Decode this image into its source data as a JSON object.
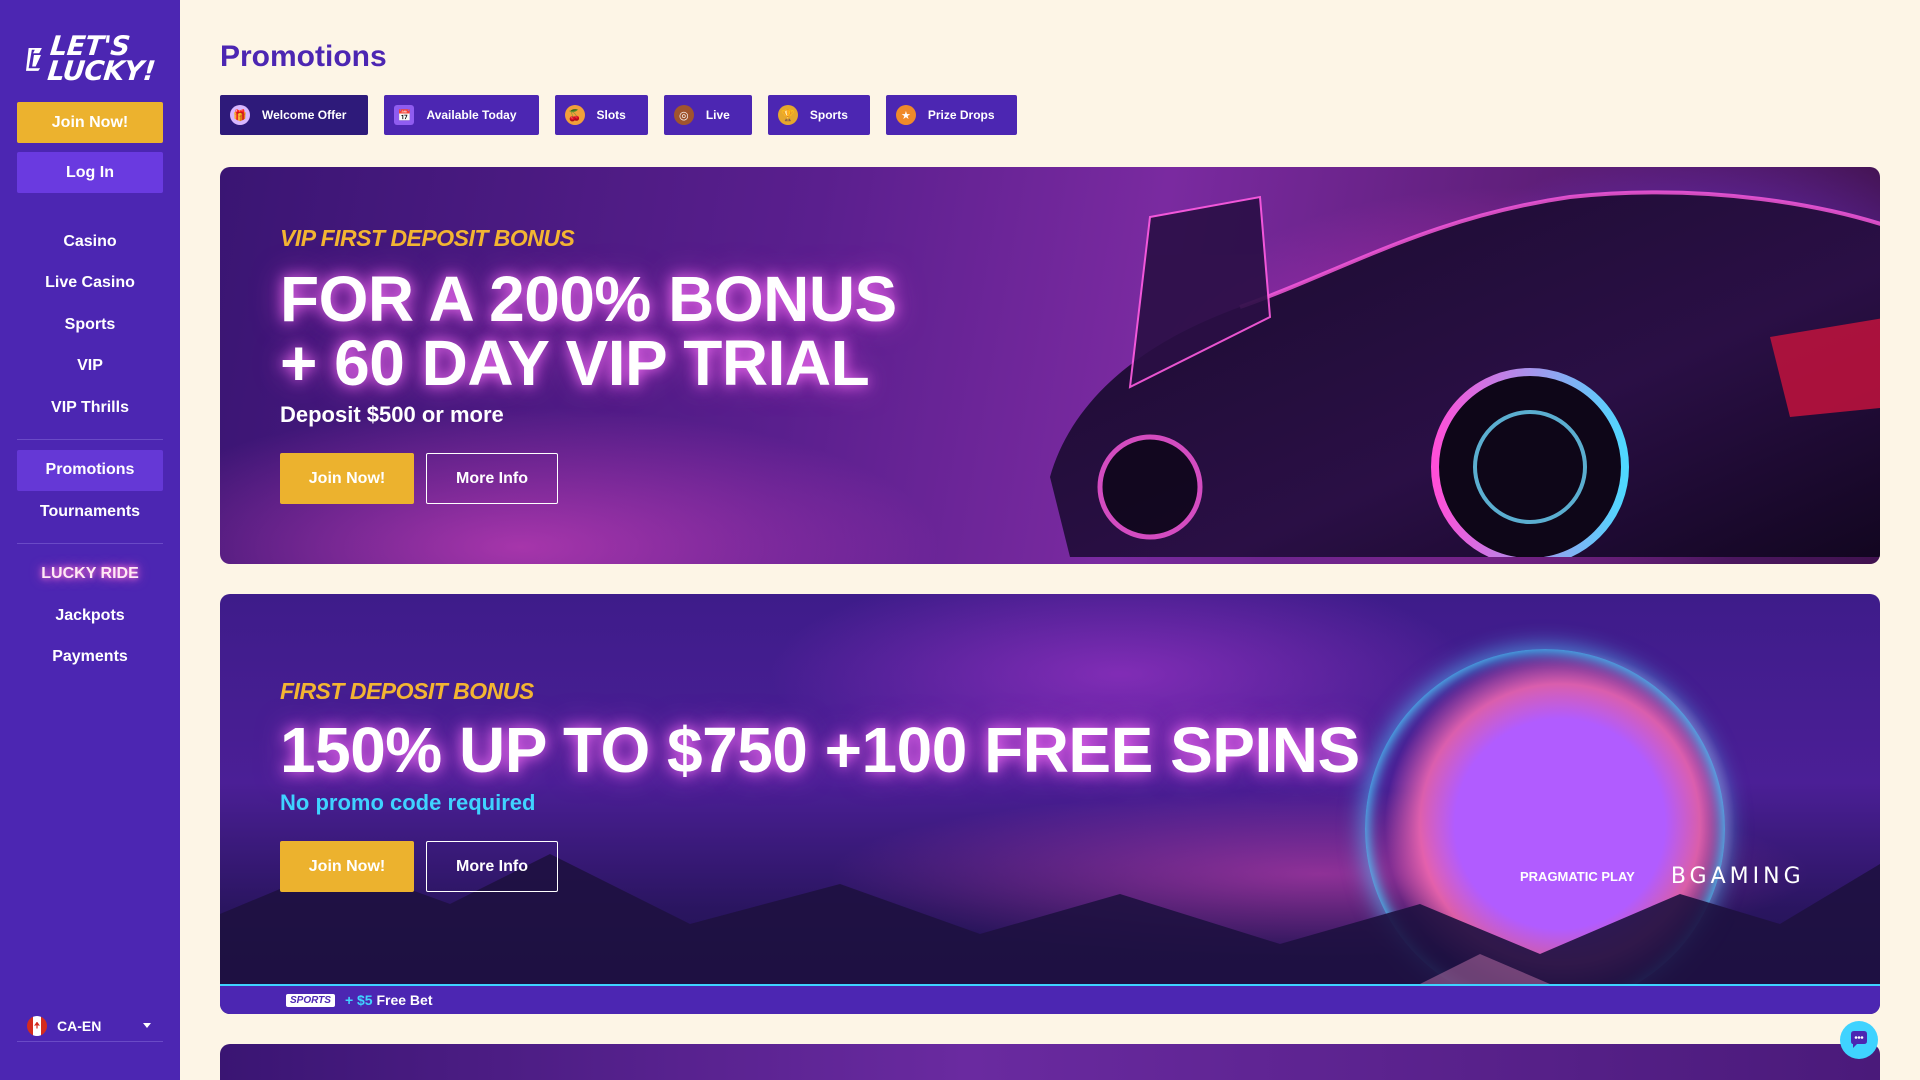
{
  "brand": {
    "logo_text_line1": "LET'S",
    "logo_text_line2": "LUCKY!"
  },
  "sidebar": {
    "join_label": "Join Now!",
    "login_label": "Log In",
    "nav_group1": [
      "Casino",
      "Live Casino",
      "Sports",
      "VIP",
      "VIP Thrills"
    ],
    "nav_group2": [
      "Promotions",
      "Tournaments"
    ],
    "nav_group3": [
      "LUCKY RIDE",
      "Jackpots",
      "Payments"
    ],
    "active": "Promotions",
    "locale": "CA-EN"
  },
  "page": {
    "title": "Promotions"
  },
  "tabs": [
    {
      "label": "Welcome Offer",
      "icon": "gift-icon"
    },
    {
      "label": "Available Today",
      "icon": "calendar-icon"
    },
    {
      "label": "Slots",
      "icon": "cherry-icon"
    },
    {
      "label": "Live",
      "icon": "roulette-icon"
    },
    {
      "label": "Sports",
      "icon": "trophy-icon"
    },
    {
      "label": "Prize Drops",
      "icon": "coin-icon"
    }
  ],
  "banners": [
    {
      "subtitle": "VIP FIRST DEPOSIT BONUS",
      "title_line1": "FOR A 200% BONUS",
      "title_line2": "+ 60 DAY VIP TRIAL",
      "description": "Deposit $500 or more",
      "join_label": "Join Now!",
      "more_label": "More Info"
    },
    {
      "subtitle": "FIRST DEPOSIT BONUS",
      "title_line1": "150% UP TO $750 +100 FREE SPINS",
      "description": "No promo code required",
      "join_label": "Join Now!",
      "more_label": "More Info",
      "providers": [
        "PRAGMATIC PLAY",
        "BGAMING"
      ],
      "sports_logo": "SPORTS",
      "sports_amount": "+ $5",
      "sports_text": "Free Bet"
    }
  ],
  "colors": {
    "primary": "#4c26b2",
    "accent": "#ecb22e",
    "cyan": "#3fd3ff",
    "background": "#fdf5e6"
  }
}
